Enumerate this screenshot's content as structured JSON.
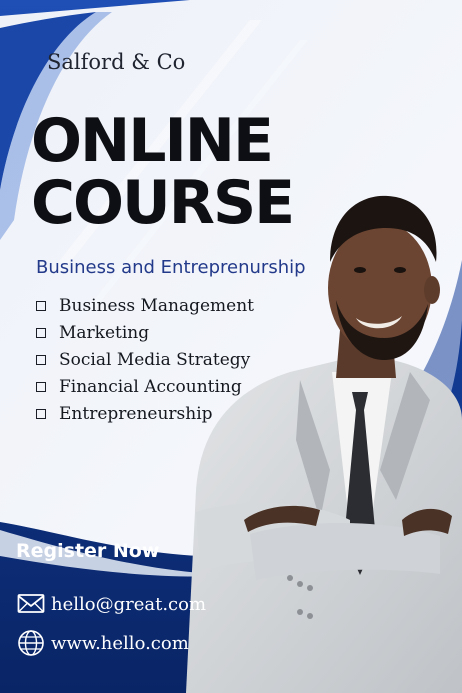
{
  "brand": "Salford & Co",
  "title_line1": "ONLINE",
  "title_line2": "COURSE",
  "subtitle": "Business and Entreprenurship",
  "topics": [
    "Business Management",
    "Marketing",
    "Social Media Strategy",
    "Financial Accounting",
    "Entrepreneurship"
  ],
  "cta": "Register Now",
  "email": "hello@great.com",
  "website": "www.hello.com",
  "colors": {
    "navy": "#0b2a6b",
    "blue": "#1d4fb8",
    "subtitle_blue": "#233a8a",
    "text_dark": "#0d0f14"
  },
  "icons": {
    "email": "envelope-icon",
    "website": "globe-icon"
  }
}
